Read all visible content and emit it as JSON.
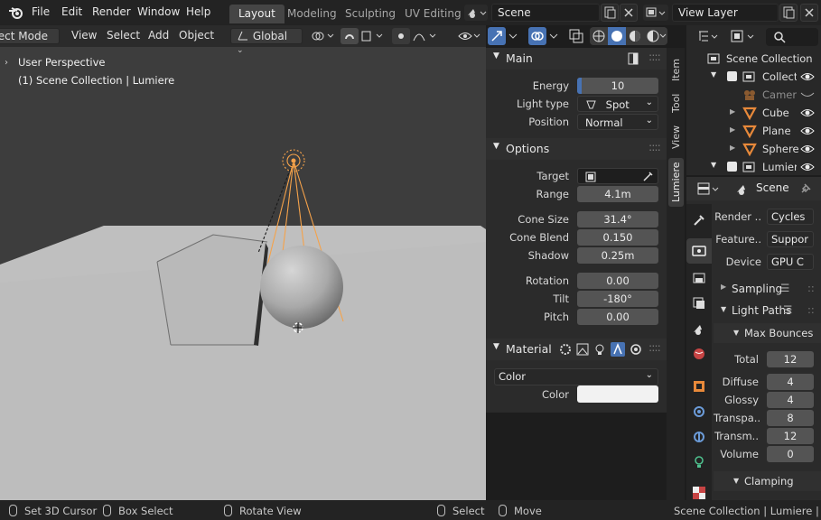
{
  "topbar": {
    "menus": [
      "File",
      "Edit",
      "Render",
      "Window",
      "Help"
    ],
    "workspaces": [
      "Layout",
      "Modeling",
      "Sculpting",
      "UV Editing"
    ],
    "active_workspace": "Layout",
    "scene": "Scene",
    "view_layer": "View Layer"
  },
  "viewport_header": {
    "mode": "Object Mode",
    "menus": [
      "View",
      "Select",
      "Add",
      "Object"
    ],
    "orientation": "Global"
  },
  "viewport": {
    "perspective_label": "User Perspective",
    "collection_label": "(1) Scene Collection | Lumiere"
  },
  "n_panel": {
    "tabs": [
      "Item",
      "Tool",
      "View",
      "Lumiere"
    ],
    "active_tab": "Lumiere",
    "main": {
      "title": "Main",
      "energy_label": "Energy",
      "energy_value": "10",
      "energy_fraction": 0.05,
      "light_type_label": "Light type",
      "light_type_value": "Spot",
      "position_label": "Position",
      "position_value": "Normal"
    },
    "options": {
      "title": "Options",
      "target_label": "Target",
      "range_label": "Range",
      "range_value": "4.1m",
      "cone_size_label": "Cone Size",
      "cone_size_value": "31.4°",
      "cone_blend_label": "Cone Blend",
      "cone_blend_value": "0.150",
      "shadow_label": "Shadow",
      "shadow_value": "0.25m",
      "rotation_label": "Rotation",
      "rotation_value": "0.00",
      "tilt_label": "Tilt",
      "tilt_value": "-180°",
      "pitch_label": "Pitch",
      "pitch_value": "0.00"
    },
    "material": {
      "title": "Material",
      "mode_value": "Color",
      "color_label": "Color",
      "color_swatch": "#f2f2f2"
    }
  },
  "outliner": {
    "root": "Scene Collection",
    "items": [
      {
        "label": "Collection",
        "display": "Collectic"
      },
      {
        "label": "Camera",
        "display": "Camera"
      },
      {
        "label": "Cube",
        "display": "Cube"
      },
      {
        "label": "Plane",
        "display": "Plane"
      },
      {
        "label": "Sphere",
        "display": "Sphere"
      },
      {
        "label": "Lumiere",
        "display": "Lumiere"
      }
    ]
  },
  "properties": {
    "scene_label": "Scene",
    "render_engine_label": "Render ..",
    "render_engine_value": "Cycles",
    "feature_set_label": "Feature..",
    "feature_set_value": "Suppor",
    "device_label": "Device",
    "device_value": "GPU C",
    "sampling_label": "Sampling",
    "light_paths_label": "Light Paths",
    "max_bounces_label": "Max Bounces",
    "bounces": [
      {
        "label": "Total",
        "value": "12"
      },
      {
        "label": "Diffuse",
        "value": "4"
      },
      {
        "label": "Glossy",
        "value": "4"
      },
      {
        "label": "Transpa..",
        "value": "8"
      },
      {
        "label": "Transm..",
        "value": "12"
      },
      {
        "label": "Volume",
        "value": "0"
      }
    ],
    "clamping_label": "Clamping"
  },
  "statusbar": {
    "set_cursor": "Set 3D Cursor",
    "box_select": "Box Select",
    "rotate_view": "Rotate View",
    "select": "Select",
    "move": "Move",
    "info": "Scene Collection | Lumiere | Vert"
  },
  "colors": {
    "accent": "#4772b3",
    "selection": "#f5a24a",
    "object_icon": "#e8893a"
  }
}
